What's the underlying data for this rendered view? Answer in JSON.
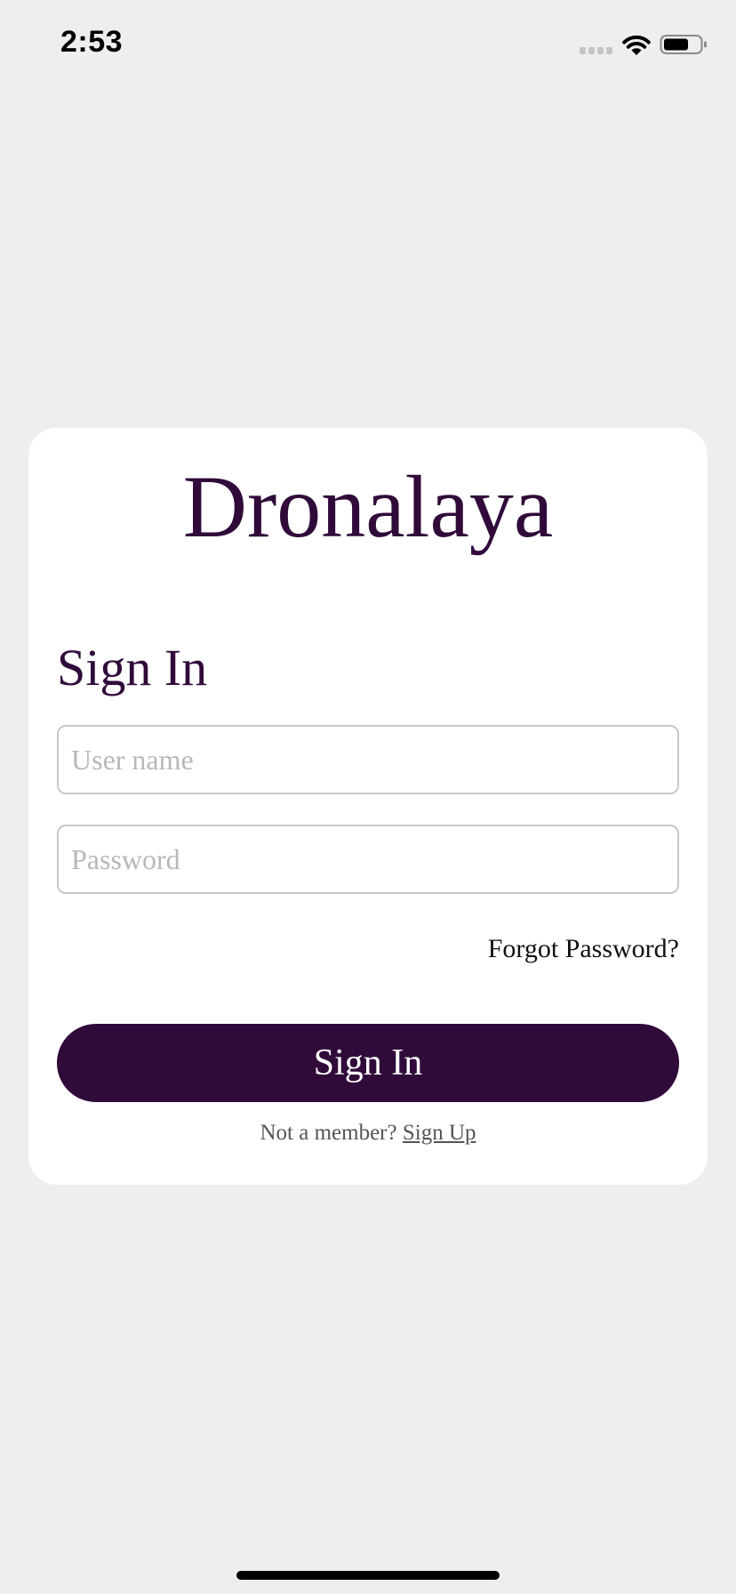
{
  "status_bar": {
    "time": "2:53",
    "icons": [
      "signal-icon",
      "wifi-icon",
      "battery-icon"
    ]
  },
  "brand": {
    "title": "Dronalaya",
    "color": "#300b3a"
  },
  "signin_form": {
    "heading": "Sign In",
    "username": {
      "value": "",
      "placeholder": "User name"
    },
    "password": {
      "value": "",
      "placeholder": "Password"
    },
    "forgot_password_label": "Forgot Password?",
    "submit_label": "Sign In",
    "signup_prompt": "Not a member?",
    "signup_link_label": "Sign Up"
  },
  "colors": {
    "background": "#eeeeee",
    "card": "#ffffff",
    "accent": "#300b3a",
    "input_border": "#c8c8c8",
    "placeholder": "#b8b8b8"
  }
}
